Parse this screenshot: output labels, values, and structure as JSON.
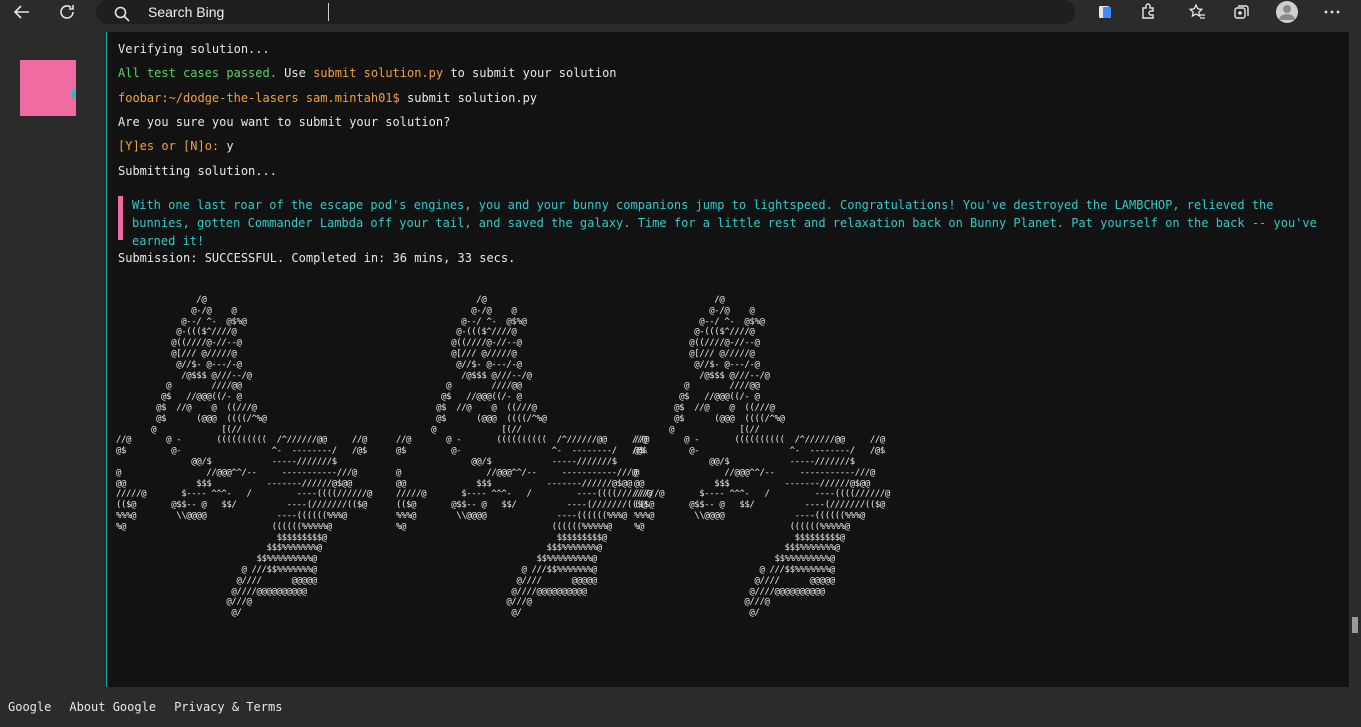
{
  "browser": {
    "search_placeholder": "Search Bing",
    "icons": [
      "back-arrow-icon",
      "refresh-icon",
      "search-icon",
      "reading-view-icon",
      "extensions-icon",
      "favorites-icon",
      "collections-icon",
      "profile-avatar-icon",
      "more-menu-icon"
    ]
  },
  "terminal": {
    "lines": {
      "verifying": "Verifying solution...",
      "passed_prefix": "All test cases passed.",
      "passed_use": " Use ",
      "passed_cmd": "submit solution.py",
      "passed_suffix": " to submit your solution",
      "prompt": "foobar:~/dodge-the-lasers sam.mintah01$",
      "prompt_cmd": " submit solution.py",
      "confirm": "Are you sure you want to submit your solution?",
      "yes_no": "[Y]es or [N]o:",
      "answer": " y",
      "submitting": "Submitting solution...",
      "message": "With one last roar of the escape pod's engines, you and your bunny companions jump to lightspeed. Congratulations! You've destroyed the LAMBCHOP, relieved the bunnies, gotten Commander Lambda off your tail, and saved the galaxy. Time for a little rest and relaxation back on Bunny Planet. Pat yourself on the back -- you've earned it!",
      "result": "Submission: SUCCESSFUL. Completed in: 36 mins, 33 secs."
    },
    "ascii_art": "                /@\n               @-/@    @\n             @--/ ^-  @$%@\n            @-((($^////@\n           @((////@-//--@\n           @[/// @/////@\n            @//$- @---/-@\n             /@$$$ @///--/@\n          @        ////@@\n         @$   //@@@((/- @\n        @$  //@    @  ((///@\n        @$      (@@@  ((((/^%@\n       @             [(//\n//@       @ -       ((((((((((  /^//////@@     //@\n@$         @-                  ^-  --------/   /@$\n               @@/$            -----///////$\n@                 //@@@^^/--     -----------///@\n@@              $$$           -------//////@$@@\n/////@       $---- ^^^-   /         ----((((//////@\n(($@       @$$-- @   $$/          ----(///////(($@\n%%%@        \\\\@@@@              ----((((((%%%@\n%@                             ((((((%%%%%@\n                                $$$$$$$$$@\n                              $$$%%%%%%%@\n                            $$%%%%%%%%%@\n                         @ ///$$%%%%%%%@\n                        @////      @@@@@\n                       @////@@@@@@@@@@\n                      @///@\n                       @/"
  },
  "footer": {
    "links": [
      "Google",
      "About Google",
      "Privacy & Terms"
    ]
  },
  "colors": {
    "accent_pink": "#f06ba2",
    "accent_teal": "#1ba4a4",
    "success_green": "#56d364",
    "highlight_orange": "#f0a13c",
    "message_cyan": "#2fc9c9"
  }
}
